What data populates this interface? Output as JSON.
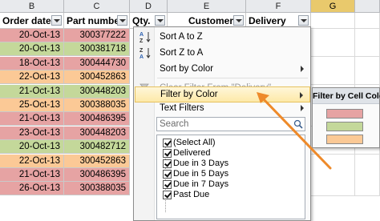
{
  "columns": [
    "B",
    "C",
    "D",
    "E",
    "F",
    "G"
  ],
  "headers": {
    "order_date": "Order date",
    "part_number": "Part number",
    "qty": "Qty.",
    "customer": "Customer",
    "delivery": "Delivery"
  },
  "rows": [
    {
      "date": "20-Oct-13",
      "part": "300377222",
      "color": "red"
    },
    {
      "date": "20-Oct-13",
      "part": "300381718",
      "color": "green"
    },
    {
      "date": "18-Oct-13",
      "part": "300444730",
      "color": "red"
    },
    {
      "date": "22-Oct-13",
      "part": "300452863",
      "color": "orange"
    },
    {
      "date": "21-Oct-13",
      "part": "300448203",
      "color": "green"
    },
    {
      "date": "25-Oct-13",
      "part": "300388035",
      "color": "orange"
    },
    {
      "date": "21-Oct-13",
      "part": "300486395",
      "color": "red"
    },
    {
      "date": "23-Oct-13",
      "part": "300448203",
      "color": "red"
    },
    {
      "date": "20-Oct-13",
      "part": "300482712",
      "color": "green"
    },
    {
      "date": "22-Oct-13",
      "part": "300452863",
      "color": "orange"
    },
    {
      "date": "21-Oct-13",
      "part": "300486395",
      "color": "red"
    },
    {
      "date": "26-Oct-13",
      "part": "300388035",
      "color": "red"
    }
  ],
  "menu": {
    "sort_az": "Sort A to Z",
    "sort_za": "Sort Z to A",
    "sort_color": "Sort by Color",
    "clear_filter": "Clear Filter From \"Delivery\"",
    "filter_color": "Filter by Color",
    "text_filters": "Text Filters",
    "search_placeholder": "Search",
    "list": [
      "(Select All)",
      "Delivered",
      "Due in 3 Days",
      "Due in 5 Days",
      "Due in 7 Days",
      "Past Due"
    ]
  },
  "submenu": {
    "title": "Filter by Cell Color",
    "swatches": [
      "#e6a3a3",
      "#c4d89a",
      "#fbc996"
    ]
  },
  "colors": {
    "red": "#e6a3a3",
    "green": "#c4d89a",
    "orange": "#fbc996",
    "selected_column": "#e9c96c",
    "arrow": "#ee8a2a"
  },
  "icons": [
    "sort-az-icon",
    "sort-za-icon",
    "clear-filter-icon",
    "search-icon",
    "checkbox-icon"
  ]
}
